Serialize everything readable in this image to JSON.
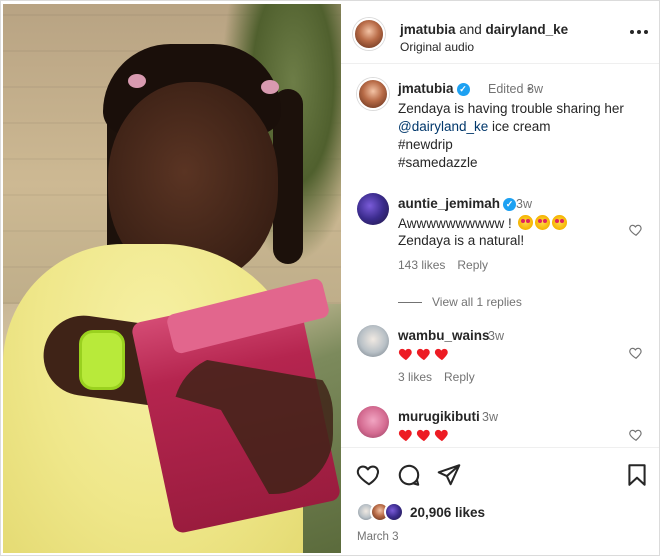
{
  "post": {
    "authors": "jmatubia",
    "authors_and": " and ",
    "coauthor": "dairyland_ke",
    "audio": "Original audio"
  },
  "caption": {
    "user": "jmatubia",
    "edited": "Edited",
    "dot": "•",
    "ago": "3w",
    "line1": "Zendaya is having trouble sharing her",
    "mention": "@dairyland_ke",
    "line2_rest": " ice cream",
    "hashtag1": "#newdrip",
    "hashtag2": "#samedazzle"
  },
  "comments": [
    {
      "user": "auntie_jemimah",
      "verified": true,
      "ago": "3w",
      "text": "Awwwwwwwwww !",
      "emojis": [
        "star-struck-emoji",
        "star-struck-emoji",
        "star-struck-emoji"
      ],
      "text2": "Zendaya is a natural!",
      "likes": "143 likes",
      "reply": "Reply"
    },
    {
      "user": "wambu_wains",
      "ago": "3w",
      "hearts": 3,
      "likes": "3 likes",
      "reply": "Reply"
    },
    {
      "user": "murugikibuti",
      "ago": "3w",
      "hearts": 3
    }
  ],
  "view_replies": "View all 1 replies",
  "likes": "20,906 likes",
  "date": "March 3",
  "icons": {
    "more": "more-options-icon",
    "like": "heart-outline-icon",
    "comment": "comment-bubble-icon",
    "share": "paper-plane-icon",
    "save": "bookmark-icon",
    "verified": "verified-badge-icon"
  },
  "colors": {
    "link": "#00376b",
    "muted": "#737373",
    "verified": "#1da1f2",
    "heart_red": "#ed1c24"
  }
}
